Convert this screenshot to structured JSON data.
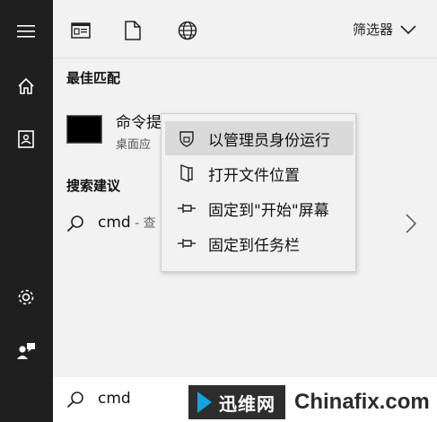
{
  "topbar": {
    "filter_label": "筛选器"
  },
  "best_match": {
    "section_title": "最佳匹配",
    "app_title": "命令提",
    "app_subtitle": "桌面应"
  },
  "suggestions": {
    "section_title": "搜索建议",
    "item_query": "cmd",
    "item_hint": " - 查"
  },
  "context_menu": {
    "items": [
      {
        "label": "以管理员身份运行",
        "icon": "shield-icon"
      },
      {
        "label": "打开文件位置",
        "icon": "folder-open-icon"
      },
      {
        "label": "固定到\"开始\"屏幕",
        "icon": "pin-icon"
      },
      {
        "label": "固定到任务栏",
        "icon": "pin-icon"
      }
    ]
  },
  "search_box": {
    "value": "cmd"
  },
  "watermark": {
    "logo_text": "迅维网",
    "site_text": "Chinafix.com"
  },
  "colors": {
    "rail": "#1f1f1f",
    "panel": "#f2f2f2",
    "highlight": "#dadada"
  }
}
